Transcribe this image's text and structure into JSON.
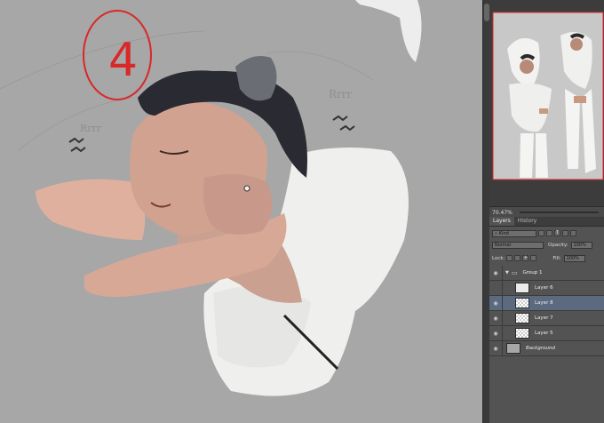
{
  "canvas": {
    "annotation_number": "4",
    "sketch_text_1": "Rrrr",
    "sketch_text_2": "Rrrr"
  },
  "navigator": {
    "zoom": "70.47%"
  },
  "panel": {
    "tabs": [
      "Layers",
      "History"
    ],
    "filter_kind": "Kind",
    "blend_mode": "Normal",
    "opacity_label": "Opacity:",
    "opacity_value": "100%",
    "lock_label": "Lock:",
    "fill_label": "Fill:",
    "fill_value": "100%"
  },
  "layers": [
    {
      "name": "Group 1",
      "type": "group",
      "visible": true,
      "selected": false
    },
    {
      "name": "Layer 6",
      "type": "layer",
      "visible": false,
      "selected": false
    },
    {
      "name": "Layer 8",
      "type": "layer",
      "visible": true,
      "selected": true
    },
    {
      "name": "Layer 7",
      "type": "layer",
      "visible": true,
      "selected": false
    },
    {
      "name": "Layer 5",
      "type": "layer",
      "visible": true,
      "selected": false
    },
    {
      "name": "Background",
      "type": "background",
      "visible": true,
      "selected": false
    }
  ],
  "colors": {
    "canvas_bg": "#a7a7a7",
    "panel_bg": "#535353",
    "selected_layer": "#5c6a80",
    "annotation_red": "#d8282a"
  }
}
